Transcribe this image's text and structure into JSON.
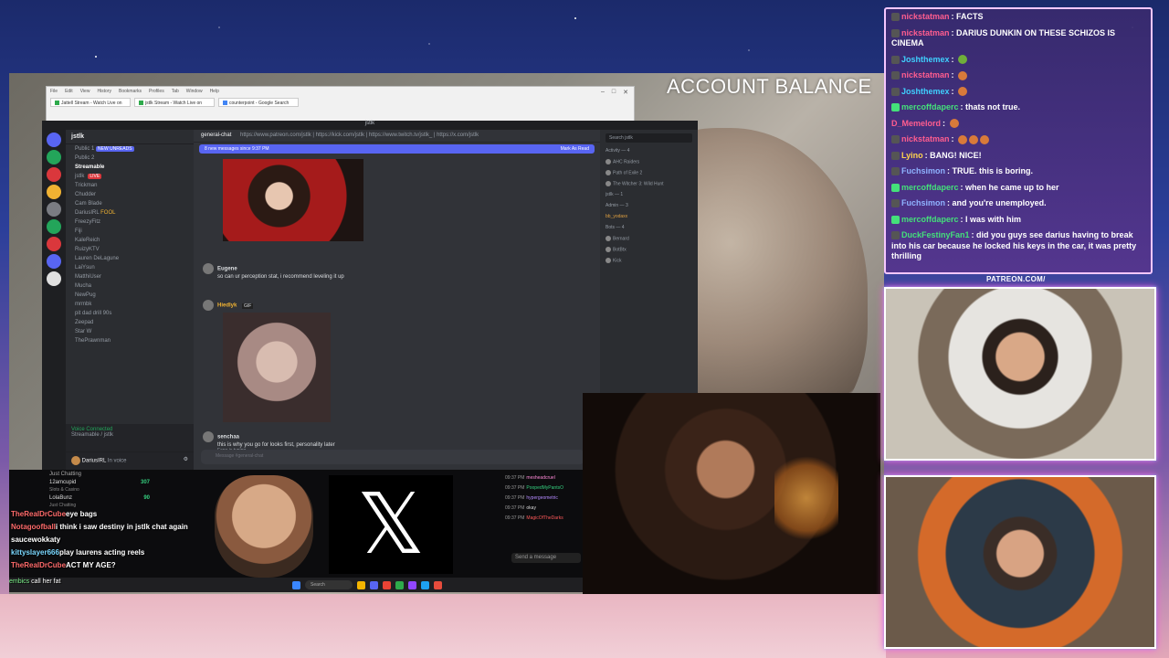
{
  "overlay": {
    "account_balance": "ACCOUNT BALANCE",
    "patreon": "PATREON.COM/"
  },
  "browser": {
    "menu": [
      "File",
      "Edit",
      "View",
      "History",
      "Bookmarks",
      "Profiles",
      "Tab",
      "Window",
      "Help"
    ],
    "tabs": [
      {
        "label": "Jattell Stream - Watch Live on"
      },
      {
        "label": "jstlk Stream - Watch Live on"
      },
      {
        "label": "counterpoint - Google Search"
      }
    ]
  },
  "discord": {
    "window_title": "jstlk",
    "server_name": "jstlk",
    "channels": [
      {
        "label": "Public 1"
      },
      {
        "label": "Public 2"
      },
      {
        "label": "Streamable",
        "selected": true
      },
      {
        "label": "jstlk",
        "live": "LIVE"
      },
      {
        "label": "Trickman"
      },
      {
        "label": "Chudder"
      },
      {
        "label": "Cam Blade"
      },
      {
        "label": "DariusIRL",
        "badge": "FOOL"
      },
      {
        "label": "FreezyFitz"
      },
      {
        "label": "Fiji"
      },
      {
        "label": "KaleReich"
      },
      {
        "label": "RuizyKTV"
      },
      {
        "label": "Lauren DeLagune"
      },
      {
        "label": "LaiYsun"
      },
      {
        "label": "MatthiUser"
      },
      {
        "label": "Mucha"
      },
      {
        "label": "NewPug"
      },
      {
        "label": "mrmbk"
      },
      {
        "label": "pit dad drill 90s"
      },
      {
        "label": "Zeepad"
      },
      {
        "label": "Star W"
      },
      {
        "label": "ThePrawnman"
      }
    ],
    "new_unreads": "NEW UNREADS",
    "voice_connected": "Voice Connected",
    "voice_channel": "Streamable / jstlk",
    "user": "DariusIRL",
    "user_status": "In voice",
    "chat_channel": "general-chat",
    "chat_topic": "https://www.patreon.com/jstlk | https://kick.com/jstlk | https://www.twitch.tv/jstlk_ | https://x.com/jstlk",
    "new_messages": "8 new messages since 9:37 PM",
    "mark_as_read": "Mark As Read",
    "messages": [
      {
        "user": "Eugene",
        "text": "so can ur perception stat, i recommend leveling it up"
      },
      {
        "user": "Hiedlyk",
        "text": "GIF"
      },
      {
        "user": "senchaa",
        "text": "this is why you go for looks first, personality later"
      }
    ],
    "typing": "Fape is typing...",
    "composer_placeholder": "Message #general-chat",
    "member_search": "Search jstlk",
    "members": [
      {
        "label": "Activity — 4"
      },
      {
        "label": "AHC Raiders"
      },
      {
        "label": "Path of Exile 2"
      },
      {
        "label": "The Witcher 3: Wild Hunt"
      },
      {
        "label": "jstlk — 1"
      },
      {
        "label": "Admin — 3"
      },
      {
        "label": "bb_yodaxx"
      },
      {
        "label": "Bots — 4"
      },
      {
        "label": "Bernard"
      },
      {
        "label": "BotBtx"
      },
      {
        "label": "Kick"
      }
    ]
  },
  "leaderboard": {
    "title": "Just Chatting",
    "rows": [
      {
        "name": "12amcupid",
        "sub": "Slots & Casino",
        "value": "307"
      },
      {
        "name": "LolaBunz",
        "sub": "Just Chatting",
        "value": "90"
      }
    ]
  },
  "small_chat": [
    {
      "time": "09:37 PM",
      "user": "mesheadcruel"
    },
    {
      "time": "09:37 PM",
      "user": "PoopedMyPantsO"
    },
    {
      "time": "09:37 PM",
      "user": "hypergeometric"
    },
    {
      "time": "09:37 PM",
      "text": "okay"
    },
    {
      "time": "09:37 PM",
      "user": "MagicOfTheDarks"
    }
  ],
  "send_message": "Send a message",
  "stream_chat": [
    {
      "user": "TheRealDrCube",
      "text": "eye bags"
    },
    {
      "user": "Notagoofball",
      "text": "i think i saw destiny in jstlk chat again"
    },
    {
      "user": "saucewokka",
      "text": "ty"
    },
    {
      "user": "kittyslayer666",
      "text": "play laurens acting reels"
    },
    {
      "user": "TheRealDrCube",
      "text": "ACT MY AGE?"
    }
  ],
  "bottom_chat": {
    "user": "embics",
    "text": "call her fat"
  },
  "taskbar": {
    "search": "Search"
  },
  "right_chat": [
    {
      "user": "nickstatman",
      "text": "FACTS",
      "color": "#ff5d8f"
    },
    {
      "user": "nickstatman",
      "text": "DARIUS DUNKIN ON THESE SCHIZOS IS CINEMA",
      "color": "#ff5d8f"
    },
    {
      "user": "Joshthemex",
      "text": "",
      "color": "#3fd0ff"
    },
    {
      "user": "nickstatman",
      "text": "",
      "color": "#ff5d8f"
    },
    {
      "user": "Joshthemex",
      "text": "",
      "color": "#3fd0ff"
    },
    {
      "user": "mercoffdaperc",
      "text": "thats not true.",
      "color": "#44e07a"
    },
    {
      "user": "D_Memelord",
      "text": "",
      "color": "#ff5d8f"
    },
    {
      "user": "nickstatman",
      "text": "",
      "color": "#ff5d8f"
    },
    {
      "user": "Lyino",
      "text": "BANG! NICE!",
      "color": "#ffd34d"
    },
    {
      "user": "Fuchsimon",
      "text": "TRUE. this is boring.",
      "color": "#8fb3ff"
    },
    {
      "user": "mercoffdaperc",
      "text": "when he came up to her",
      "color": "#44e07a"
    },
    {
      "user": "Fuchsimon",
      "text": "and you're unemployed.",
      "color": "#8fb3ff"
    },
    {
      "user": "mercoffdaperc",
      "text": "I was with him",
      "color": "#44e07a"
    },
    {
      "user": "DuckFestinyFan1",
      "text": "did you guys see darius having to break into his car because he locked his keys in the car, it was pretty thrilling",
      "color": "#44e07a"
    }
  ]
}
